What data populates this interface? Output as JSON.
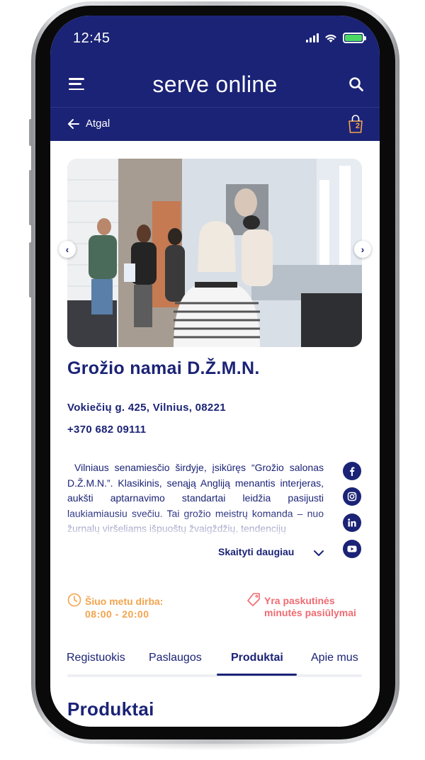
{
  "status_bar": {
    "time": "12:45"
  },
  "header": {
    "logo_part1": "serve",
    "logo_part2": " online"
  },
  "nav": {
    "back_label": "Atgal",
    "cart_count": "2"
  },
  "business": {
    "name": "Grožio namai D.Ž.M.N.",
    "address": "Vokiečių g. 425, Vilnius, 08221",
    "phone": "+370 682 09111",
    "description": "Vilniaus senamiesčio širdyje, įsikūręs “Grožio salonas D.Ž.M.N.”. Klasikinis, senąją Angliją menantis interjeras, aukšti aptarnavimo standartai leidžia pasijusti laukiamiausiu svečiu. Tai grožio meistrų komanda – nuo žurnalų viršeliams išpuoštų žvaigždžių, tendencijų",
    "read_more": "Skaityti daugiau"
  },
  "social": [
    "facebook-icon",
    "instagram-icon",
    "linkedin-icon",
    "youtube-icon"
  ],
  "info": {
    "hours_label": "Šiuo metu dirba:",
    "hours_time": "08:00 - 20:00",
    "offer_line1": "Yra paskutinės",
    "offer_line2": "minutės pasiūlymai"
  },
  "tabs": [
    {
      "label": "Registuokis",
      "active": false
    },
    {
      "label": "Paslaugos",
      "active": false
    },
    {
      "label": "Produktai",
      "active": true
    },
    {
      "label": "Apie mus",
      "active": false
    }
  ],
  "section": {
    "title": "Produktai"
  },
  "colors": {
    "primary": "#1b2376",
    "orange": "#f3a34c",
    "coral": "#f06b72"
  }
}
